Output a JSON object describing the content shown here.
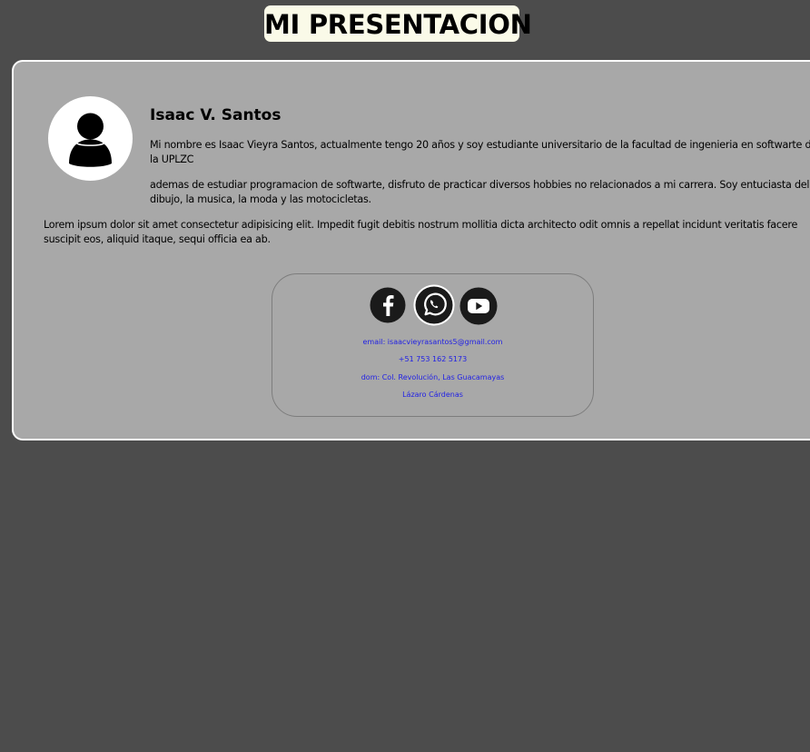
{
  "header": {
    "title": "MI PRESENTACION"
  },
  "profile": {
    "avatar_icon": "user-silhouette-icon",
    "name": "Isaac V. Santos",
    "paragraphs": [
      "Mi nombre es Isaac Vieyra Santos, actualmente tengo 20 años y soy estudiante universitario de la facultad de ingenieria en softwarte de la UPLZC",
      "ademas de estudiar programacion de softwarte, disfruto de practicar diversos hobbies no relacionados a mi carrera. Soy entuciasta del dibujo, la musica, la moda y las motocicletas.",
      "Lorem ipsum dolor sit amet consectetur adipisicing elit. Impedit fugit debitis nostrum mollitia dicta architecto odit omnis a repellat incidunt veritatis facere suscipit eos, aliquid itaque, sequi officia ea ab."
    ]
  },
  "contact": {
    "social": [
      {
        "icon": "facebook-icon"
      },
      {
        "icon": "whatsapp-icon"
      },
      {
        "icon": "youtube-icon"
      }
    ],
    "email": "email: isaacvieyrasantos5@gmail.com",
    "phone": "+51 753 162 5173",
    "address_line1": "dom: Col. Revolución, Las Guacamayas",
    "address_line2": "Lázaro Cárdenas"
  },
  "colors": {
    "background": "#4c4c4c",
    "card": "#a8a8a8",
    "title_bg": "#fafae8",
    "link": "#1f1fe6"
  }
}
